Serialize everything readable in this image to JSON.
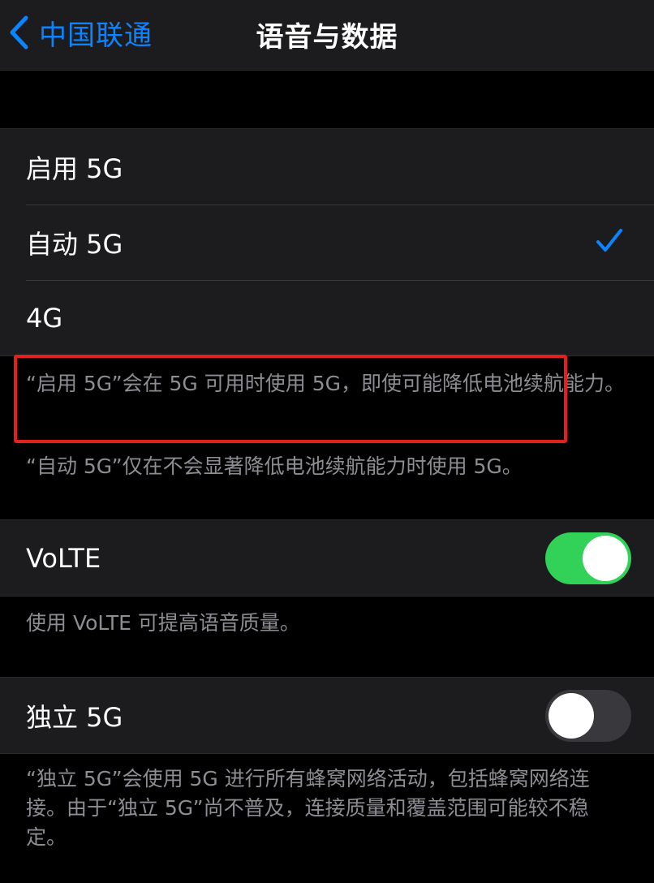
{
  "navbar": {
    "back_label": "中国联通",
    "title": "语音与数据"
  },
  "network_options": [
    {
      "label": "启用 5G",
      "selected": false
    },
    {
      "label": "自动 5G",
      "selected": true
    },
    {
      "label": "4G",
      "selected": false
    }
  ],
  "network_footnotes": {
    "line1": "“启用 5G”会在 5G 可用时使用 5G，即使可能降低电池续航能力。",
    "line2": "“自动 5G”仅在不会显著降低电池续航能力时使用 5G。"
  },
  "volte": {
    "label": "VoLTE",
    "enabled": true,
    "footnote": "使用 VoLTE 可提高语音质量。"
  },
  "standalone_5g": {
    "label": "独立 5G",
    "enabled": false,
    "footnote": "“独立 5G”会使用 5G 进行所有蜂窝网络活动，包括蜂窝网络连接。由于“独立 5G”尚不普及，连接质量和覆盖范围可能较不稳定。"
  },
  "colors": {
    "accent": "#0a84ff",
    "toggle_on": "#32d158",
    "toggle_off": "#39393d",
    "highlight_border": "#e3201b"
  }
}
